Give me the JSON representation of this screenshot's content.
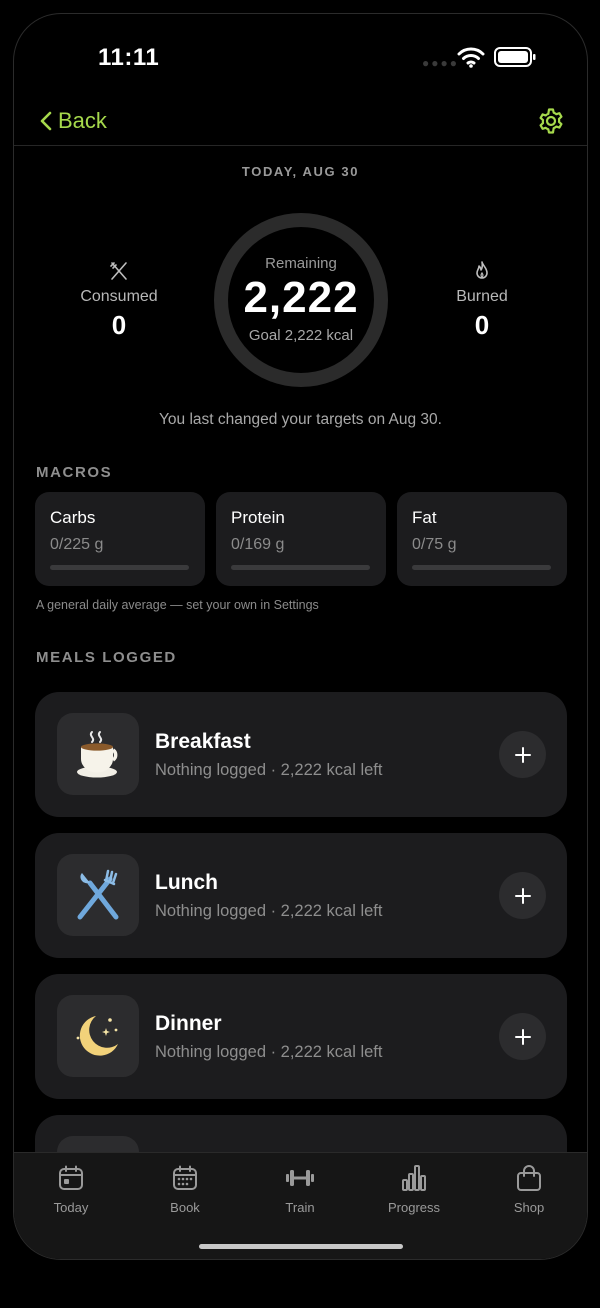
{
  "status_bar": {
    "time": "11:11"
  },
  "nav": {
    "back_label": "Back"
  },
  "date_label": "TODAY, AUG 30",
  "summary": {
    "consumed_label": "Consumed",
    "consumed_value": "0",
    "remaining_label": "Remaining",
    "remaining_value": "2,222",
    "goal_text": "Goal 2,222 kcal",
    "burned_label": "Burned",
    "burned_value": "0",
    "progress_fraction": 0
  },
  "targets_note": "You last changed your targets on Aug 30.",
  "macros": {
    "title": "MACROS",
    "items": [
      {
        "name": "Carbs",
        "value": "0/225 g",
        "fraction": 0
      },
      {
        "name": "Protein",
        "value": "0/169 g",
        "fraction": 0
      },
      {
        "name": "Fat",
        "value": "0/75 g",
        "fraction": 0
      }
    ],
    "hint": "A general daily average — set your own in Settings"
  },
  "meals": {
    "title": "MEALS LOGGED",
    "items": [
      {
        "name": "Breakfast",
        "status": "Nothing logged · 2,222 kcal left",
        "icon": "coffee-cup-icon"
      },
      {
        "name": "Lunch",
        "status": "Nothing logged · 2,222 kcal left",
        "icon": "fork-knife-icon"
      },
      {
        "name": "Dinner",
        "status": "Nothing logged · 2,222 kcal left",
        "icon": "moon-stars-icon"
      }
    ]
  },
  "tabs": [
    {
      "label": "Today",
      "icon": "calendar-icon"
    },
    {
      "label": "Book",
      "icon": "calendar-grid-icon"
    },
    {
      "label": "Train",
      "icon": "dumbbell-icon"
    },
    {
      "label": "Progress",
      "icon": "bar-chart-icon"
    },
    {
      "label": "Shop",
      "icon": "shopping-bag-icon"
    }
  ],
  "colors": {
    "accent": "#a6d94c",
    "card": "#1c1c1e",
    "background": "#000000"
  }
}
